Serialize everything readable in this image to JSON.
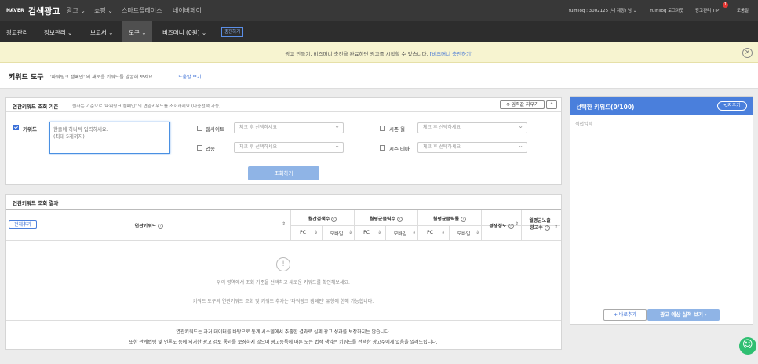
{
  "topbar": {
    "logo_brand": "NAVER",
    "logo_title": "검색광고",
    "menu": [
      "광고",
      "쇼핑",
      "스마트플레이스",
      "네이버페이"
    ],
    "account": "fulfilloq : 3002125 (내 계정) 님",
    "logout": "fulfilloq 로그아웃",
    "tip": "광고관리 TIP",
    "tip_badge": "1",
    "help": "도움말"
  },
  "navbar": {
    "items": [
      "광고관리",
      "정보관리",
      "보고서",
      "도구",
      "비즈머니 (0원)"
    ],
    "charge_button": "충전하기"
  },
  "notice": {
    "text": "광고 만들기, 비즈머니 충전을 완료하면 광고를 시작할 수 있습니다.",
    "link": "[비즈머니 충전하기]"
  },
  "page": {
    "title": "키워드 도구",
    "desc": "'파워링크 캠페인' 의 새로운 키워드를 발굴해 보세요.",
    "help_link": "도움말 보기"
  },
  "search_panel": {
    "title": "연관키워드 조회 기준",
    "desc": "원하는 기준으로 '파워링크 캠페인' 의 연관키워드를 조회하세요.(다중선택 가능)",
    "reset_button": "입력값 지우기",
    "keyword_label": "키워드",
    "keyword_placeholder": "한줄에 하나씩 입력하세요.\n(최대 5개까지)",
    "website_label": "웹사이트",
    "website_select": "체크 후 선택하세요",
    "industry_label": "업종",
    "industry_select": "체크 후 선택하세요",
    "season_month_label": "시즌 월",
    "season_month_select": "체크 후 선택하세요",
    "season_theme_label": "시즌 테마",
    "season_theme_select": "체크 후 선택하세요",
    "submit_button": "조회하기"
  },
  "results_panel": {
    "title": "연관키워드 조회 결과",
    "add_all_button": "전체추가",
    "col_keyword": "연관키워드",
    "col_search_count": "월간검색수",
    "col_avg_clicks": "월평균클릭수",
    "col_avg_ctr": "월평균클릭률",
    "col_competition": "경쟁정도",
    "col_avg_ads_line1": "월평균노출",
    "col_avg_ads_line2": "광고수",
    "sub_pc": "PC",
    "sub_mobile": "모바일",
    "empty_icon": "!",
    "empty_line1": "위의 영역에서 조회 기준을 선택하고 새로운 키워드를 확인해보세요.",
    "empty_line2": "키워드 도구의 연관키워드 조회 및 키워드 추가는 '파워링크 캠페인' 유형에 한해 가능합니다.",
    "footer_line1": "연관키워드는 과거 데이터를 바탕으로 통계 시스템에서 추출한 결과로 실제 광고 성과를 보장하지는 않습니다.",
    "footer_line2": "또한 관계법령 및 언론도 등에 의거한 광고 검토 통과를 보장하지 않으며 광고등록에 따른 모든 법적 책임은 키워드를 선택한 광고주에게 있음을 알려드립니다."
  },
  "selected_panel": {
    "title": "선택한 키워드(0/100)",
    "reset_button": "지우기",
    "direct_input": "직접입력",
    "add_button": "+ 바로추가",
    "estimate_button": "광고 예상 실적 보기 ›"
  }
}
